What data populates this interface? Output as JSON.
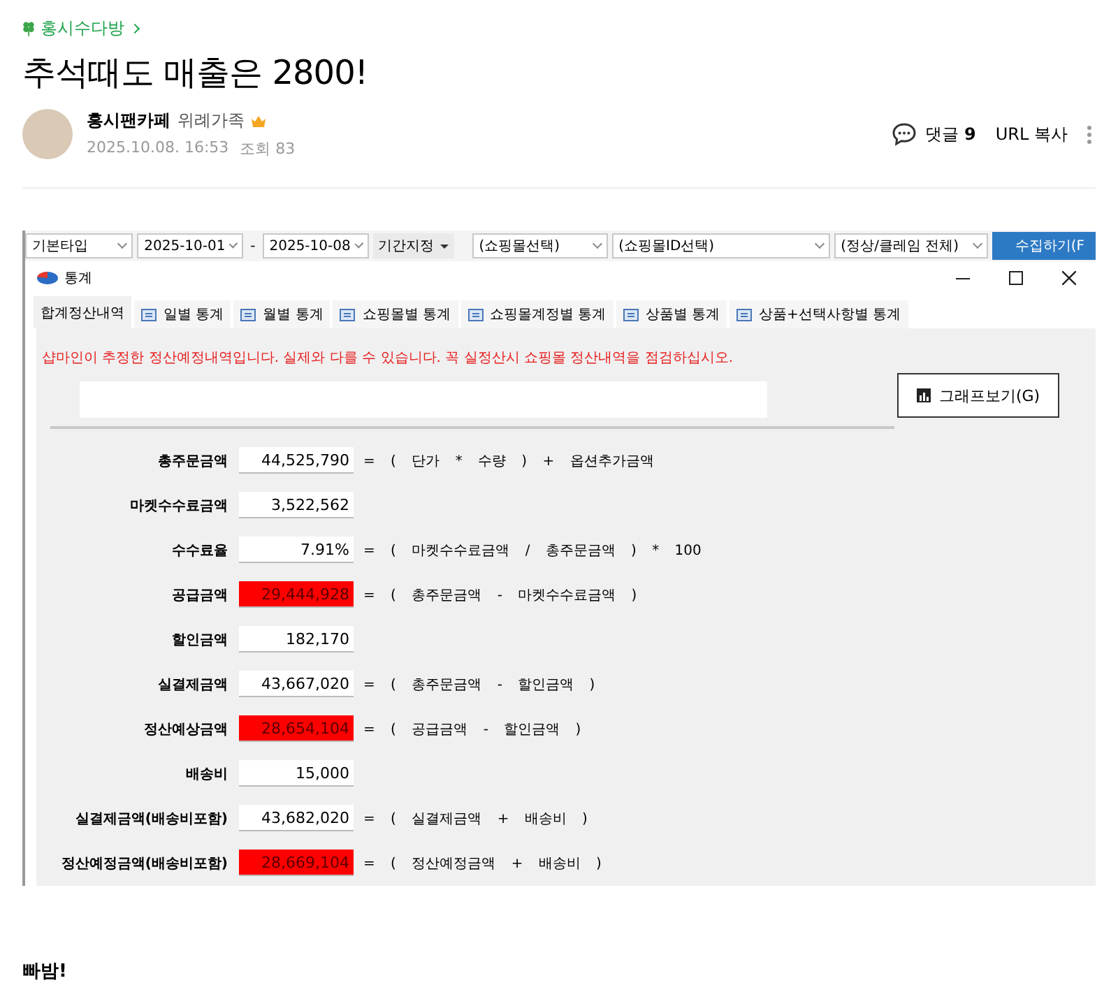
{
  "post": {
    "category": "홍시수다방",
    "title": "추석때도 매출은 2800!",
    "author": "홍시팬카페",
    "rank": "위례가족",
    "date": "2025.10.08. 16:53",
    "views": "조회 83",
    "comments_label": "댓글",
    "comments_count": "9",
    "url_copy": "URL 복사",
    "body": "빠밤!"
  },
  "toolbar": [
    {
      "kind": "select",
      "text": "기본타입"
    },
    {
      "kind": "select",
      "text": "2025-10-01"
    },
    {
      "kind": "sep",
      "text": "-"
    },
    {
      "kind": "select",
      "text": "2025-10-08"
    },
    {
      "kind": "menu",
      "text": "기간지정"
    },
    {
      "kind": "select",
      "text": "(쇼핑몰선택)"
    },
    {
      "kind": "select",
      "text": "(쇼핑몰ID선택)"
    },
    {
      "kind": "select",
      "text": "(정상/클레임 전체)"
    },
    {
      "kind": "primary",
      "text": "수집하기(F"
    }
  ],
  "dialog": {
    "title": "통계",
    "tabs": [
      {
        "label": "합계정산내역",
        "selected": true
      },
      {
        "label": "일별 통계",
        "selected": false
      },
      {
        "label": "월별 통계",
        "selected": false
      },
      {
        "label": "쇼핑몰별 통계",
        "selected": false
      },
      {
        "label": "쇼핑몰계정별 통계",
        "selected": false
      },
      {
        "label": "상품별 통계",
        "selected": false
      },
      {
        "label": "상품+선택사항별 통계",
        "selected": false
      }
    ],
    "warning": "샵마인이 추정한 정산예정내역입니다. 실제와 다를 수 있습니다. 꼭 실정산시 쇼핑몰 정산내역을 점검하십시오.",
    "graph_button": "그래프보기(G)",
    "rows": [
      {
        "label": "총주문금액",
        "value": "44,525,790",
        "highlight": false,
        "formula": "= ( 단가 * 수량 ) + 옵션추가금액"
      },
      {
        "label": "마켓수수료금액",
        "value": "3,522,562",
        "highlight": false
      },
      {
        "label": "수수료율",
        "value": "7.91%",
        "highlight": false,
        "formula": "= ( 마켓수수료금액 / 총주문금액 ) * 100"
      },
      {
        "label": "공급금액",
        "value": "29,444,928",
        "highlight": true,
        "formula": "= ( 총주문금액 - 마켓수수료금액 )"
      },
      {
        "label": "할인금액",
        "value": "182,170",
        "highlight": false
      },
      {
        "label": "실결제금액",
        "value": "43,667,020",
        "highlight": false,
        "formula": "= ( 총주문금액 - 할인금액 )"
      },
      {
        "label": "정산예상금액",
        "value": "28,654,104",
        "highlight": true,
        "formula": "= ( 공급금액 - 할인금액 )"
      },
      {
        "label": "배송비",
        "value": "15,000",
        "highlight": false
      },
      {
        "label": "실결제금액(배송비포함)",
        "value": "43,682,020",
        "highlight": false,
        "formula": "= ( 실결제금액 + 배송비 )"
      },
      {
        "label": "정산예정금액(배송비포함)",
        "value": "28,669,104",
        "highlight": true,
        "formula": "= ( 정산예정금액 + 배송비 )"
      }
    ]
  }
}
